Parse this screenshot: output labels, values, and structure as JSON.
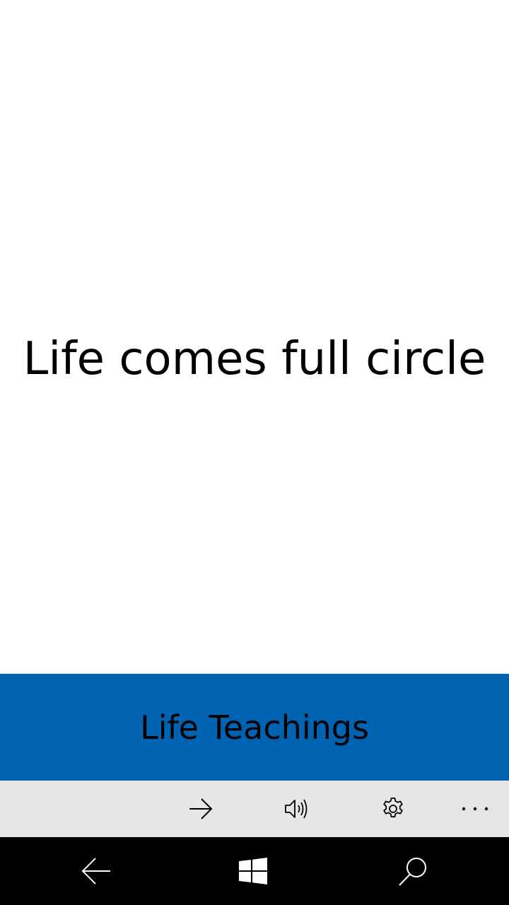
{
  "quote": {
    "text": "Life comes full circle"
  },
  "banner": {
    "title": "Life Teachings",
    "color": "#0063b1"
  },
  "appbar": {
    "background": "#e6e6e6",
    "buttons": [
      {
        "icon": "arrow-right-icon"
      },
      {
        "icon": "speaker-icon"
      },
      {
        "icon": "gear-icon"
      },
      {
        "icon": "more-icon"
      }
    ]
  },
  "navbar": {
    "background": "#000000",
    "buttons": [
      {
        "icon": "back-arrow-icon"
      },
      {
        "icon": "windows-icon"
      },
      {
        "icon": "search-icon"
      }
    ]
  }
}
